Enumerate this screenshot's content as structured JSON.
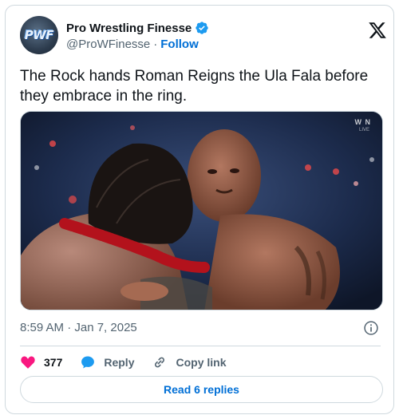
{
  "author": {
    "display_name": "Pro Wrestling Finesse",
    "handle": "@ProWFinesse",
    "separator": "·",
    "follow_label": "Follow",
    "avatar_text": "PWF",
    "verified": true
  },
  "tweet": {
    "text": "The Rock hands Roman Reigns the Ula Fala before they embrace in the ring.",
    "timestamp": "8:59 AM · Jan 7, 2025",
    "media_watermark": "W N",
    "media_watermark_sub": "LIVE"
  },
  "actions": {
    "likes_count": "377",
    "reply_label": "Reply",
    "copy_link_label": "Copy link"
  },
  "read_replies_label": "Read 6 replies",
  "colors": {
    "like": "#f91880",
    "reply": "#1d9bf0",
    "link": "#006fd6",
    "verified": "#1d9bf0"
  },
  "icons": [
    "verified-badge-icon",
    "x-logo-icon",
    "info-icon",
    "heart-icon",
    "reply-bubble-icon",
    "link-icon"
  ]
}
